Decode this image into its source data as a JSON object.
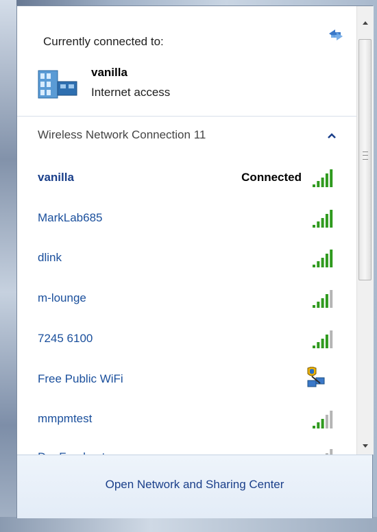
{
  "current": {
    "title": "Currently connected to:",
    "network_name": "vanilla",
    "network_status": "Internet access",
    "refresh_icon": "refresh-icon",
    "network_icon": "network-building-icon"
  },
  "section": {
    "label": "Wireless Network Connection 11",
    "collapse_icon": "chevron-up-icon"
  },
  "networks": [
    {
      "name": "vanilla",
      "status": "Connected",
      "signal": 5,
      "icon": "signal-bars-icon"
    },
    {
      "name": "MarkLab685",
      "status": "",
      "signal": 5,
      "icon": "signal-bars-icon"
    },
    {
      "name": "dlink",
      "status": "",
      "signal": 5,
      "icon": "signal-bars-icon"
    },
    {
      "name": "m-lounge",
      "status": "",
      "signal": 4,
      "icon": "signal-bars-icon"
    },
    {
      "name": "7245 6100",
      "status": "",
      "signal": 4,
      "icon": "signal-bars-icon"
    },
    {
      "name": "Free Public WiFi",
      "status": "",
      "signal": 0,
      "icon": "adhoc-shield-icon"
    },
    {
      "name": "mmpmtest",
      "status": "",
      "signal": 3,
      "icon": "signal-bars-icon"
    },
    {
      "name": "DogFood.net",
      "status": "",
      "signal": 2,
      "icon": "signal-bars-icon"
    }
  ],
  "footer": {
    "link": "Open Network and Sharing Center"
  },
  "colors": {
    "bar_on": "#2f9a1e",
    "bar_off": "#b5b5b5",
    "link": "#1a4f9c"
  }
}
